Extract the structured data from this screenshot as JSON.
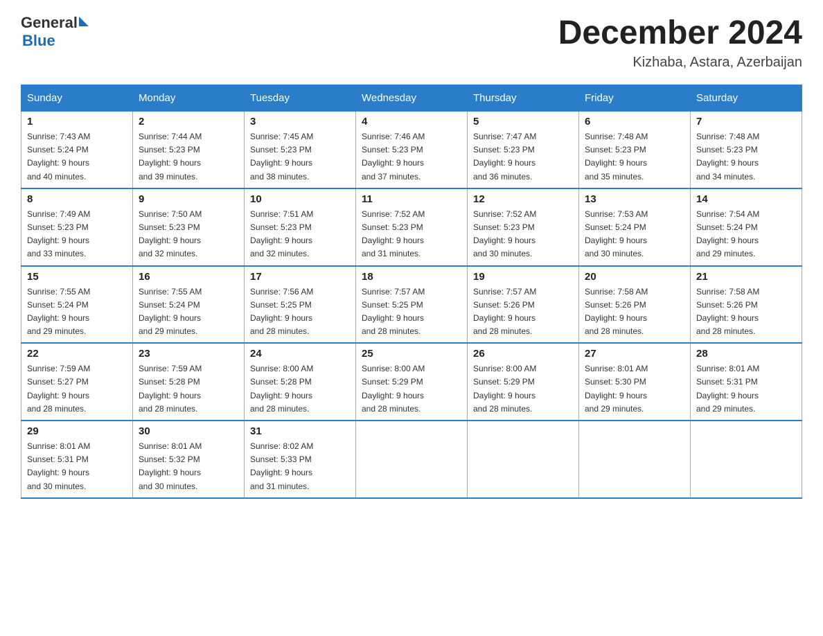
{
  "logo": {
    "general": "General",
    "triangle": "▶",
    "blue": "Blue"
  },
  "title": "December 2024",
  "location": "Kizhaba, Astara, Azerbaijan",
  "days_of_week": [
    "Sunday",
    "Monday",
    "Tuesday",
    "Wednesday",
    "Thursday",
    "Friday",
    "Saturday"
  ],
  "weeks": [
    [
      {
        "day": "1",
        "sunrise": "7:43 AM",
        "sunset": "5:24 PM",
        "daylight": "9 hours and 40 minutes."
      },
      {
        "day": "2",
        "sunrise": "7:44 AM",
        "sunset": "5:23 PM",
        "daylight": "9 hours and 39 minutes."
      },
      {
        "day": "3",
        "sunrise": "7:45 AM",
        "sunset": "5:23 PM",
        "daylight": "9 hours and 38 minutes."
      },
      {
        "day": "4",
        "sunrise": "7:46 AM",
        "sunset": "5:23 PM",
        "daylight": "9 hours and 37 minutes."
      },
      {
        "day": "5",
        "sunrise": "7:47 AM",
        "sunset": "5:23 PM",
        "daylight": "9 hours and 36 minutes."
      },
      {
        "day": "6",
        "sunrise": "7:48 AM",
        "sunset": "5:23 PM",
        "daylight": "9 hours and 35 minutes."
      },
      {
        "day": "7",
        "sunrise": "7:48 AM",
        "sunset": "5:23 PM",
        "daylight": "9 hours and 34 minutes."
      }
    ],
    [
      {
        "day": "8",
        "sunrise": "7:49 AM",
        "sunset": "5:23 PM",
        "daylight": "9 hours and 33 minutes."
      },
      {
        "day": "9",
        "sunrise": "7:50 AM",
        "sunset": "5:23 PM",
        "daylight": "9 hours and 32 minutes."
      },
      {
        "day": "10",
        "sunrise": "7:51 AM",
        "sunset": "5:23 PM",
        "daylight": "9 hours and 32 minutes."
      },
      {
        "day": "11",
        "sunrise": "7:52 AM",
        "sunset": "5:23 PM",
        "daylight": "9 hours and 31 minutes."
      },
      {
        "day": "12",
        "sunrise": "7:52 AM",
        "sunset": "5:23 PM",
        "daylight": "9 hours and 30 minutes."
      },
      {
        "day": "13",
        "sunrise": "7:53 AM",
        "sunset": "5:24 PM",
        "daylight": "9 hours and 30 minutes."
      },
      {
        "day": "14",
        "sunrise": "7:54 AM",
        "sunset": "5:24 PM",
        "daylight": "9 hours and 29 minutes."
      }
    ],
    [
      {
        "day": "15",
        "sunrise": "7:55 AM",
        "sunset": "5:24 PM",
        "daylight": "9 hours and 29 minutes."
      },
      {
        "day": "16",
        "sunrise": "7:55 AM",
        "sunset": "5:24 PM",
        "daylight": "9 hours and 29 minutes."
      },
      {
        "day": "17",
        "sunrise": "7:56 AM",
        "sunset": "5:25 PM",
        "daylight": "9 hours and 28 minutes."
      },
      {
        "day": "18",
        "sunrise": "7:57 AM",
        "sunset": "5:25 PM",
        "daylight": "9 hours and 28 minutes."
      },
      {
        "day": "19",
        "sunrise": "7:57 AM",
        "sunset": "5:26 PM",
        "daylight": "9 hours and 28 minutes."
      },
      {
        "day": "20",
        "sunrise": "7:58 AM",
        "sunset": "5:26 PM",
        "daylight": "9 hours and 28 minutes."
      },
      {
        "day": "21",
        "sunrise": "7:58 AM",
        "sunset": "5:26 PM",
        "daylight": "9 hours and 28 minutes."
      }
    ],
    [
      {
        "day": "22",
        "sunrise": "7:59 AM",
        "sunset": "5:27 PM",
        "daylight": "9 hours and 28 minutes."
      },
      {
        "day": "23",
        "sunrise": "7:59 AM",
        "sunset": "5:28 PM",
        "daylight": "9 hours and 28 minutes."
      },
      {
        "day": "24",
        "sunrise": "8:00 AM",
        "sunset": "5:28 PM",
        "daylight": "9 hours and 28 minutes."
      },
      {
        "day": "25",
        "sunrise": "8:00 AM",
        "sunset": "5:29 PM",
        "daylight": "9 hours and 28 minutes."
      },
      {
        "day": "26",
        "sunrise": "8:00 AM",
        "sunset": "5:29 PM",
        "daylight": "9 hours and 28 minutes."
      },
      {
        "day": "27",
        "sunrise": "8:01 AM",
        "sunset": "5:30 PM",
        "daylight": "9 hours and 29 minutes."
      },
      {
        "day": "28",
        "sunrise": "8:01 AM",
        "sunset": "5:31 PM",
        "daylight": "9 hours and 29 minutes."
      }
    ],
    [
      {
        "day": "29",
        "sunrise": "8:01 AM",
        "sunset": "5:31 PM",
        "daylight": "9 hours and 30 minutes."
      },
      {
        "day": "30",
        "sunrise": "8:01 AM",
        "sunset": "5:32 PM",
        "daylight": "9 hours and 30 minutes."
      },
      {
        "day": "31",
        "sunrise": "8:02 AM",
        "sunset": "5:33 PM",
        "daylight": "9 hours and 31 minutes."
      },
      null,
      null,
      null,
      null
    ]
  ]
}
